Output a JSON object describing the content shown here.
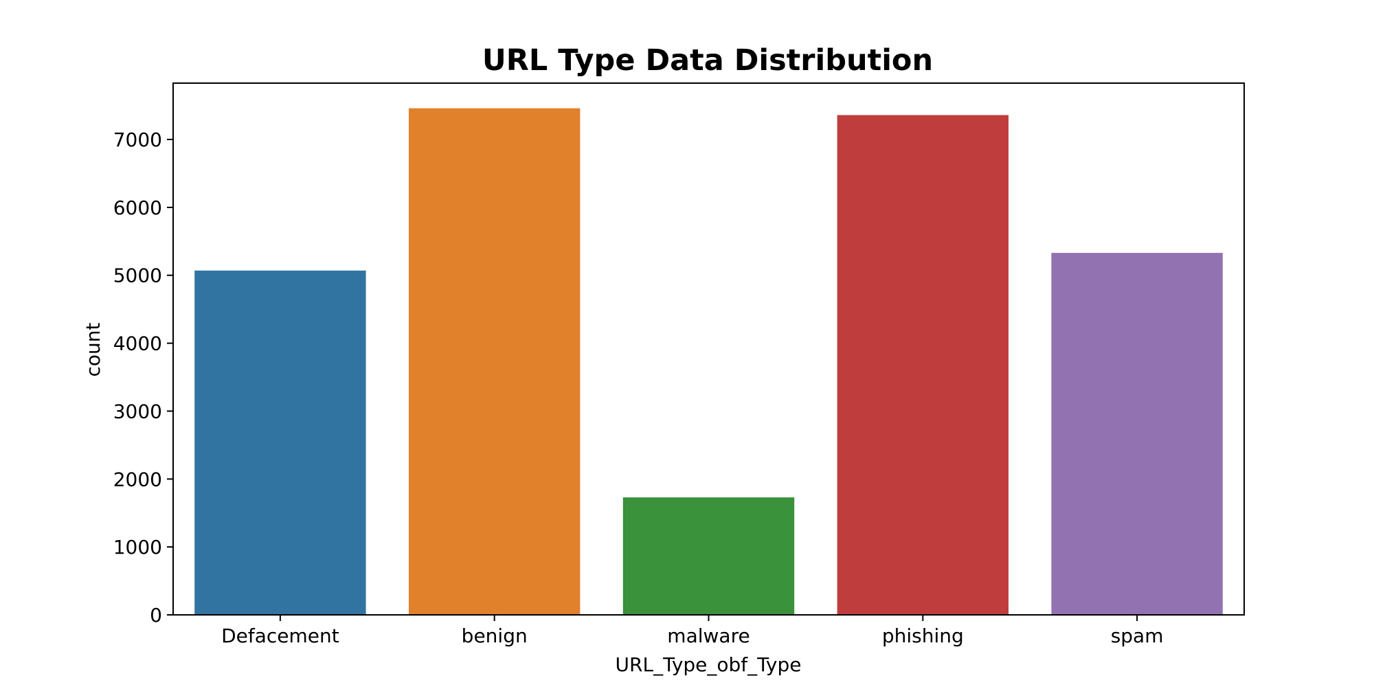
{
  "chart_data": {
    "type": "bar",
    "title": "URL Type Data Distribution",
    "xlabel": "URL_Type_obf_Type",
    "ylabel": "count",
    "categories": [
      "Defacement",
      "benign",
      "malware",
      "phishing",
      "spam"
    ],
    "values": [
      5070,
      7460,
      1730,
      7360,
      5330
    ],
    "colors": [
      "#3274a1",
      "#e1812c",
      "#3a923a",
      "#c03d3e",
      "#9372b2"
    ],
    "ylim": [
      0,
      7830
    ],
    "yticks": [
      0,
      1000,
      2000,
      3000,
      4000,
      5000,
      6000,
      7000
    ],
    "grid": false,
    "legend": "none"
  }
}
